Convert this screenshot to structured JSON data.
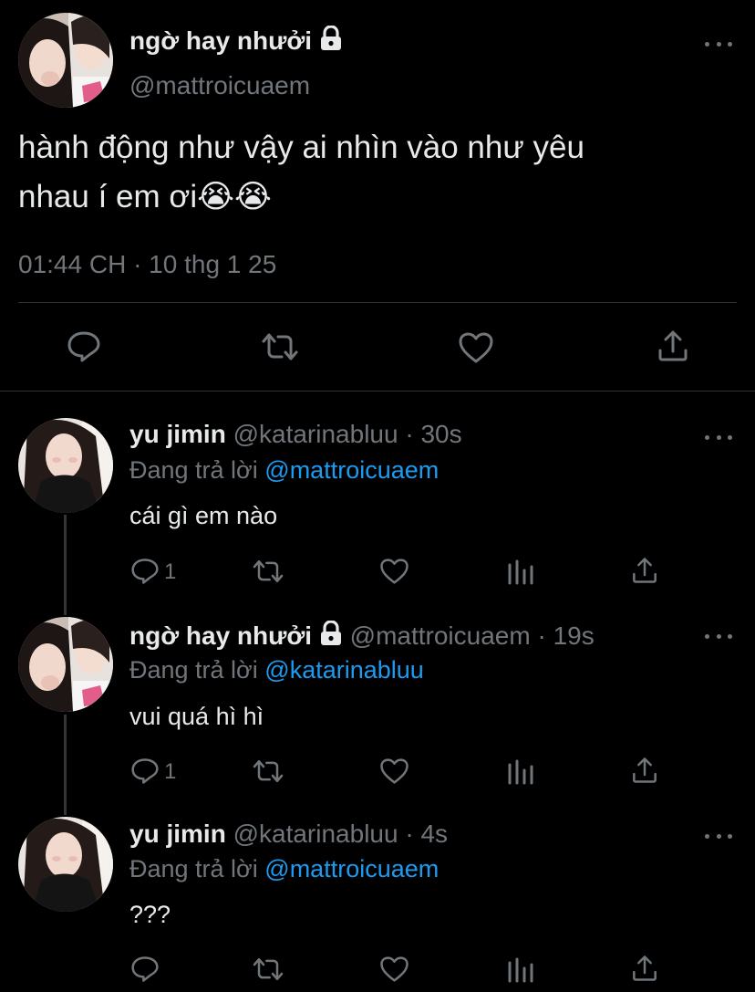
{
  "main_tweet": {
    "display_name": "ngờ hay nhưởi",
    "handle": "@mattroicuaem",
    "text_line1": "hành động như vậy ai nhìn vào như yêu",
    "text_line2": "nhau í em ơi😭😭",
    "timestamp": "01:44 CH · 10 thg 1 25",
    "icons": [
      "reply-icon",
      "retweet-icon",
      "like-icon",
      "share-icon"
    ]
  },
  "replies": [
    {
      "display_name": "yu jimin",
      "handle": "@katarinabluu",
      "time": "· 30s",
      "replying_prefix": "Đang trả lời",
      "replying_to": "@mattroicuaem",
      "text": "cái gì em nào",
      "reply_count": "1",
      "locked": false
    },
    {
      "display_name": "ngờ hay nhưởi",
      "handle": "@mattroicuaem",
      "time": "· 19s",
      "replying_prefix": "Đang trả lời",
      "replying_to": "@katarinabluu",
      "text": "vui quá hì hì",
      "reply_count": "1",
      "locked": true
    },
    {
      "display_name": "yu jimin",
      "handle": "@katarinabluu",
      "time": "· 4s",
      "replying_prefix": "Đang trả lời",
      "replying_to": "@mattroicuaem",
      "text": "???",
      "reply_count": "",
      "locked": false
    }
  ],
  "colors": {
    "background": "#000000",
    "text": "#e7e9ea",
    "muted": "#71767b",
    "accent": "#1d9bf0",
    "divider": "#2f3336"
  }
}
